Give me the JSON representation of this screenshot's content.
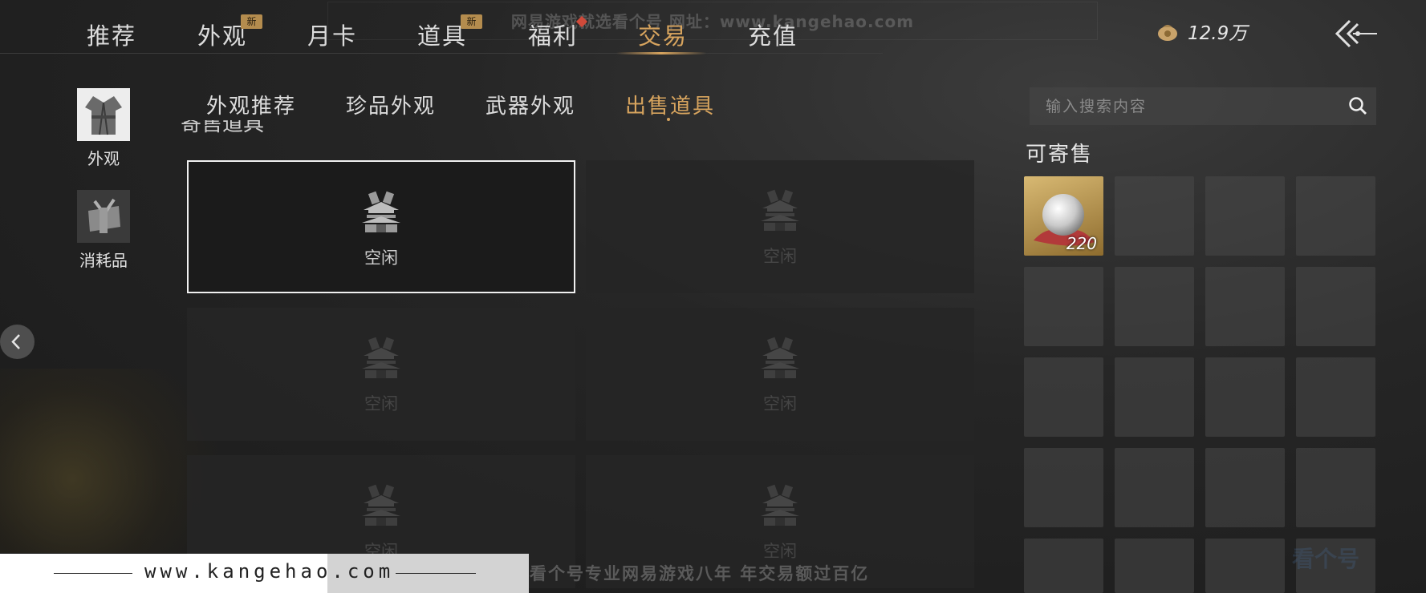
{
  "top_nav": {
    "tabs": [
      {
        "label": "推荐",
        "new": false
      },
      {
        "label": "外观",
        "new": true
      },
      {
        "label": "月卡",
        "new": false
      },
      {
        "label": "道具",
        "new": true
      },
      {
        "label": "福利",
        "new": false
      },
      {
        "label": "交易",
        "new": false,
        "active": true
      },
      {
        "label": "充值",
        "new": false
      }
    ],
    "new_badge": "新",
    "currency_value": "12.9万",
    "currency_icon": "coin-pouch-icon",
    "back_icon": "back-arrow-icon"
  },
  "sidebar": {
    "categories": [
      {
        "label": "外观",
        "icon": "robe-icon",
        "selected": true
      },
      {
        "label": "消耗品",
        "icon": "bundle-icon",
        "selected": false
      }
    ]
  },
  "sub_tabs": [
    {
      "label": "外观推荐"
    },
    {
      "label": "珍品外观"
    },
    {
      "label": "武器外观"
    },
    {
      "label": "出售道具",
      "active": true
    }
  ],
  "slots": {
    "partial_heading": "寄售道具",
    "status_label": "空闲",
    "slot_icon": "pavilion-icon",
    "count": 6
  },
  "search": {
    "placeholder": "输入搜索内容",
    "icon": "search-icon"
  },
  "sellable": {
    "title": "可寄售",
    "items": [
      {
        "icon": "pearl-icon",
        "quantity": "220"
      }
    ],
    "empty_cells": 19
  },
  "watermarks": {
    "top": "网易游戏就选看个号   网址：www.kangehao.com",
    "bottom_url": "www.kangehao.com",
    "bottom_text": "看个号专业网易游戏八年   年交易额过百亿",
    "logo": "看个号"
  },
  "colors": {
    "accent": "#d7a45e",
    "new_badge": "#b48c4e",
    "background": "#262626"
  }
}
